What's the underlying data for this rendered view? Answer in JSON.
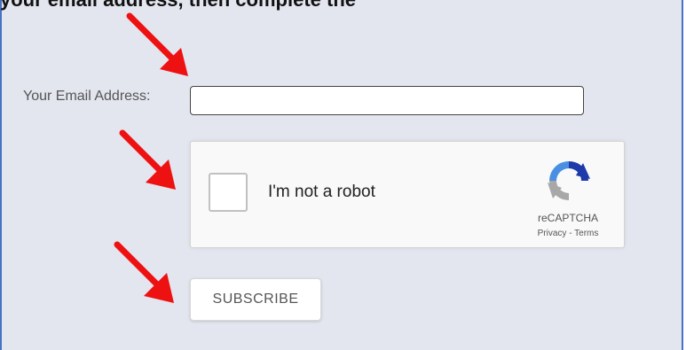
{
  "header_text": "your email address, then complete the",
  "form": {
    "email_label": "Your Email Address:",
    "email_value": "",
    "captcha": {
      "checkbox_label": "I'm not a robot",
      "brand": "reCAPTCHA",
      "privacy_link": "Privacy",
      "separator": " - ",
      "terms_link": "Terms"
    },
    "subscribe_label": "SUBSCRIBE"
  },
  "colors": {
    "panel_background": "#e3e5ef",
    "panel_border": "#4a72c4",
    "arrow": "#ee1111"
  },
  "icons": [
    "red-arrow-icon",
    "recaptcha-logo-icon"
  ]
}
